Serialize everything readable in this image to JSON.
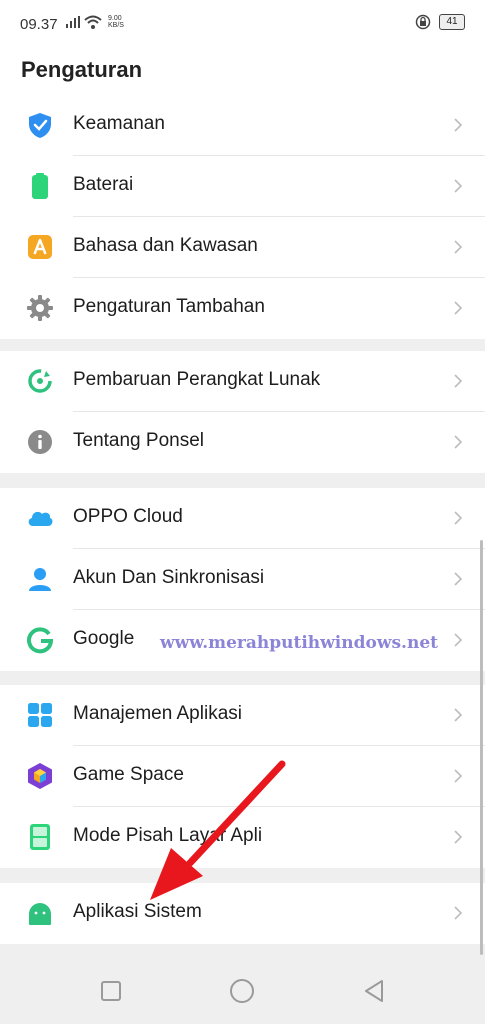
{
  "status_bar": {
    "time": "09.37",
    "net_speed_value": "9.00",
    "net_speed_unit": "KB/S",
    "battery": "41"
  },
  "header": {
    "title": "Pengaturan"
  },
  "groups": [
    {
      "items": [
        {
          "label": "Keamanan",
          "icon": "shield-icon"
        },
        {
          "label": "Baterai",
          "icon": "battery-icon"
        },
        {
          "label": "Bahasa dan Kawasan",
          "icon": "language-icon"
        },
        {
          "label": "Pengaturan Tambahan",
          "icon": "gear-icon"
        }
      ]
    },
    {
      "items": [
        {
          "label": "Pembaruan Perangkat Lunak",
          "icon": "update-icon"
        },
        {
          "label": "Tentang Ponsel",
          "icon": "info-icon"
        }
      ]
    },
    {
      "items": [
        {
          "label": "OPPO Cloud",
          "icon": "cloud-icon"
        },
        {
          "label": "Akun Dan Sinkronisasi",
          "icon": "account-icon"
        },
        {
          "label": "Google",
          "icon": "google-icon"
        }
      ]
    },
    {
      "items": [
        {
          "label": "Manajemen Aplikasi",
          "icon": "apps-grid-icon"
        },
        {
          "label": "Game Space",
          "icon": "game-space-icon"
        },
        {
          "label": "Mode Pisah Layar Apli",
          "icon": "split-screen-icon"
        }
      ]
    },
    {
      "items": [
        {
          "label": "Aplikasi Sistem",
          "icon": "android-icon"
        }
      ]
    }
  ],
  "watermark": "www.merahputihwindows.net",
  "colors": {
    "shield": "#2f8ff0",
    "battery": "#2ed47a",
    "language": "#f5a623",
    "gear": "#8a8a8a",
    "update": "#2ec27e",
    "info": "#8a8a8a",
    "cloud": "#2aa7ef",
    "account": "#2a9df4",
    "google": "#2ec27e",
    "apps": "#2aa7ef",
    "android": "#2ec27e",
    "arrow": "#e8171d",
    "watermark": "#8b84d8"
  },
  "nav_bar": {
    "buttons": [
      "recent-apps-icon",
      "home-icon",
      "back-icon"
    ]
  }
}
